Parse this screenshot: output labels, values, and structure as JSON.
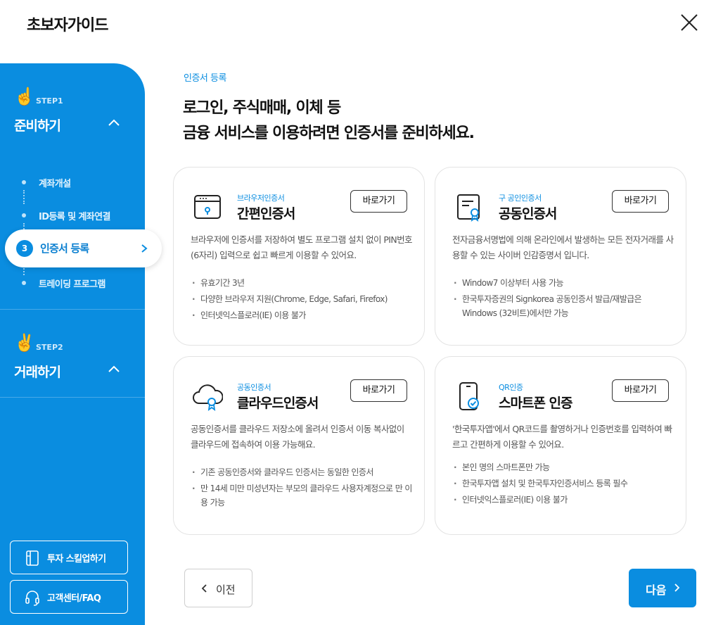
{
  "header": {
    "title": "초보자가이드",
    "close_icon": "close-icon"
  },
  "sidebar": {
    "step1": {
      "emoji": "☝️",
      "label": "STEP1",
      "title": "준비하기"
    },
    "substeps": [
      "계좌개설",
      "ID등록 및 계좌연결",
      "인증서 등록",
      "트레이딩 프로그램"
    ],
    "active": {
      "number": "3",
      "label": "인증서 등록"
    },
    "step2": {
      "emoji": "✌️",
      "label": "STEP2",
      "title": "거래하기"
    },
    "buttons": {
      "skill_up": "투자 스킬업하기",
      "help": "고객센터/FAQ"
    }
  },
  "main": {
    "section_label": "인증서 등록",
    "headline_line1": "로그인, 주식매매, 이체 등",
    "headline_line2": "금융 서비스를 이용하려면 인증서를 준비하세요.",
    "cards": [
      {
        "subtitle": "브라우저인증서",
        "title": "간편인증서",
        "button": "바로가기",
        "description": "브라우저에 인증서를 저장하여 별도 프로그램 설치 없이 PIN번호(6자리) 입력으로 쉽고 빠르게 이용할 수 있어요.",
        "bullets": [
          "유효기간 3년",
          "다양한 브라우저 지원(Chrome, Edge, Safari, Firefox)",
          "인터넷익스플로러(IE) 이용 불가"
        ]
      },
      {
        "subtitle": "구 공인인증서",
        "title": "공동인증서",
        "button": "바로가기",
        "description": "전자금융서명법에 의해 온라인에서 발생하는 모든 전자거래를 사용할 수 있는 사이버 인감증명서 입니다.",
        "bullets": [
          "Window7 이상부터 사용 가능",
          "한국투자증권의 Signkorea 공동인증서 발급/재발급은 Windows (32비트)에서만 가능"
        ]
      },
      {
        "subtitle": "공동인증서",
        "title": "클라우드인증서",
        "button": "바로가기",
        "description": "공동인증서를 클라우드 저장소에 올려서 인증서 이동 복사없이 클라우드에 접속하여 이용 가능해요.",
        "bullets": [
          "기존 공동인증서와 클라우드 인증서는 동일한 인증서",
          "만 14세 미만 미성년자는 부모의 클라우드 사용자계정으로 만 이용 가능"
        ]
      },
      {
        "subtitle": "QR인증",
        "title": "스마트폰 인증",
        "button": "바로가기",
        "description": "'한국투자앱'에서 QR코드를 촬영하거나 인증번호를 입력하여 빠르고 간편하게 이용할 수 있어요.",
        "bullets": [
          "본인 명의 스마트폰만 가능",
          "한국투자앱 설치 및 한국투자인증서비스 등록 필수",
          "인터넷익스플로러(IE) 이용 불가"
        ]
      }
    ]
  },
  "footer": {
    "prev_label": "이전",
    "next_label": "다음"
  },
  "colors": {
    "brand_blue": "#0a8de0",
    "text_dark": "#111111",
    "text_gray": "#555555"
  }
}
